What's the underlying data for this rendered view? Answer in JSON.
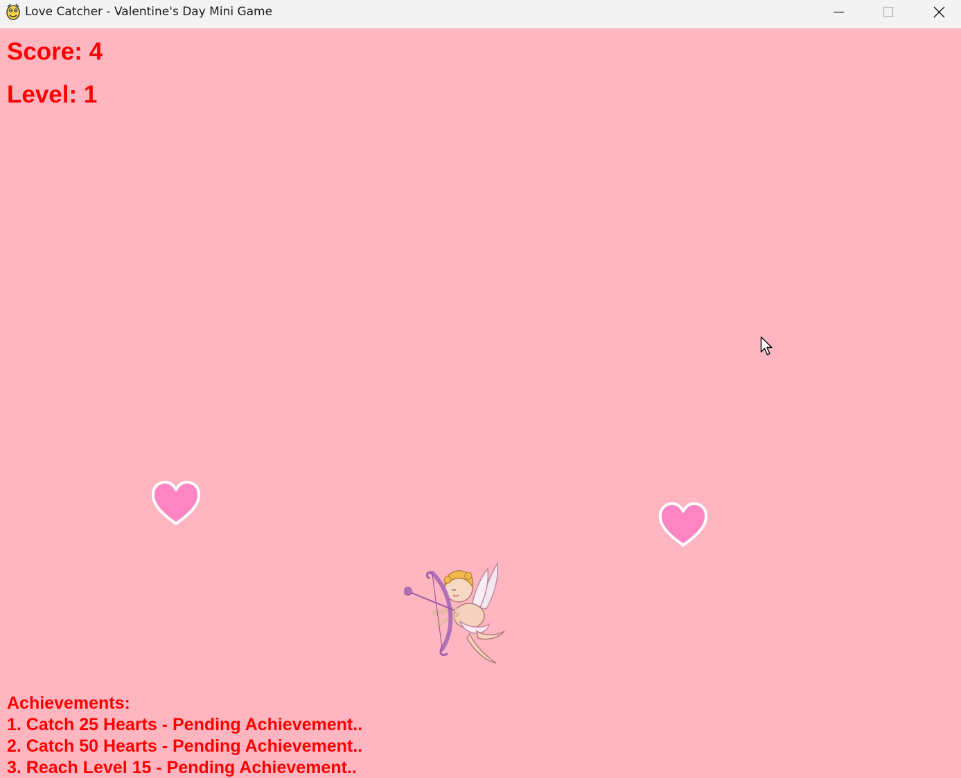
{
  "window": {
    "title": "Love Catcher - Valentine's Day Mini Game",
    "controls": {
      "minimize_icon": "minimize-icon",
      "maximize_icon": "maximize-icon",
      "close_icon": "close-icon"
    }
  },
  "hud": {
    "score": "Score: 4",
    "level": "Level: 1"
  },
  "achievements": {
    "heading": "Achievements:",
    "items": [
      "1. Catch 25 Hearts - Pending Achievement..",
      "2. Catch 50 Hearts - Pending Achievement..",
      "3. Reach Level 15 - Pending Achievement.."
    ]
  },
  "sprites": {
    "heart_icon": "heart-icon",
    "player_icon": "cupid-icon",
    "heart_count": 2
  },
  "colors": {
    "background": "#ffb6c1",
    "hud_text": "#ff0000",
    "heart_fill": "#ff85c2",
    "heart_outline": "#ffffff"
  }
}
